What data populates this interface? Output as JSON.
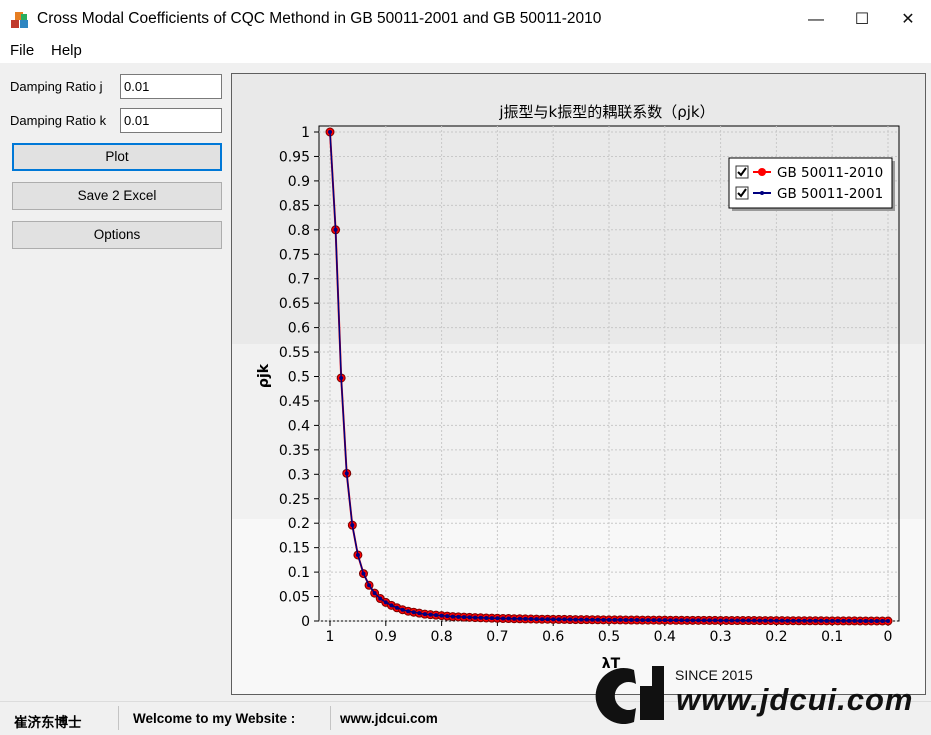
{
  "window": {
    "title": "Cross Modal Coefficients of CQC Methond in GB 50011-2001 and GB 50011-2010",
    "minimize_glyph": "—",
    "maximize_glyph": "☐",
    "close_glyph": "✕"
  },
  "menu": {
    "file": "File",
    "help": "Help"
  },
  "controls": {
    "damping_j_label": "Damping Ratio j",
    "damping_j_value": "0.01",
    "damping_k_label": "Damping Ratio k",
    "damping_k_value": "0.01",
    "plot_button": "Plot",
    "save_button": "Save 2 Excel",
    "options_button": "Options"
  },
  "status": {
    "author": "崔济东博士",
    "welcome": "Welcome to my Website :",
    "website": "www.jdcui.com"
  },
  "watermark": {
    "since": "SINCE 2015",
    "url": "www.jdcui.com"
  },
  "chart_data": {
    "type": "line",
    "title": "j振型与k振型的耦联系数（ρjk）",
    "xlabel": "λT",
    "ylabel": "ρjk",
    "x_ticks": [
      "1",
      "0.9",
      "0.8",
      "0.7",
      "0.6",
      "0.5",
      "0.4",
      "0.3",
      "0.2",
      "0.1",
      "0"
    ],
    "y_ticks": [
      "0",
      "0.05",
      "0.1",
      "0.15",
      "0.2",
      "0.25",
      "0.3",
      "0.35",
      "0.4",
      "0.45",
      "0.5",
      "0.55",
      "0.6",
      "0.65",
      "0.7",
      "0.75",
      "0.8",
      "0.85",
      "0.9",
      "0.95",
      "1"
    ],
    "xlim": [
      1,
      0
    ],
    "ylim": [
      0,
      1
    ],
    "x_reversed": true,
    "grid": true,
    "legend_position": "top-right",
    "series": [
      {
        "name": "GB 50011-2010",
        "checked": true,
        "color": "#ff0000",
        "marker": "circle-large"
      },
      {
        "name": "GB 50011-2001",
        "checked": true,
        "color": "#000080",
        "marker": "circle-small"
      }
    ],
    "x": [
      1.0,
      0.99,
      0.98,
      0.97,
      0.96,
      0.95,
      0.94,
      0.93,
      0.92,
      0.91,
      0.9,
      0.89,
      0.88,
      0.87,
      0.86,
      0.85,
      0.84,
      0.83,
      0.82,
      0.81,
      0.8,
      0.79,
      0.78,
      0.77,
      0.76,
      0.75,
      0.74,
      0.73,
      0.72,
      0.71,
      0.7,
      0.69,
      0.68,
      0.67,
      0.66,
      0.65,
      0.64,
      0.63,
      0.62,
      0.61,
      0.6,
      0.59,
      0.58,
      0.57,
      0.56,
      0.55,
      0.54,
      0.53,
      0.52,
      0.51,
      0.5,
      0.49,
      0.48,
      0.47,
      0.46,
      0.45,
      0.44,
      0.43,
      0.42,
      0.41,
      0.4,
      0.39,
      0.38,
      0.37,
      0.36,
      0.35,
      0.34,
      0.33,
      0.32,
      0.31,
      0.3,
      0.29,
      0.28,
      0.27,
      0.26,
      0.25,
      0.24,
      0.23,
      0.22,
      0.21,
      0.2,
      0.19,
      0.18,
      0.17,
      0.16,
      0.15,
      0.14,
      0.13,
      0.12,
      0.11,
      0.1,
      0.09,
      0.08,
      0.07,
      0.06,
      0.05,
      0.04,
      0.03,
      0.02,
      0.01,
      0.0
    ],
    "values": [
      1.0,
      0.8,
      0.497,
      0.302,
      0.196,
      0.135,
      0.097,
      0.073,
      0.057,
      0.046,
      0.038,
      0.032,
      0.027,
      0.023,
      0.02,
      0.018,
      0.016,
      0.014,
      0.013,
      0.012,
      0.011,
      0.01,
      0.009,
      0.0085,
      0.008,
      0.0075,
      0.007,
      0.0066,
      0.0062,
      0.0058,
      0.0055,
      0.0052,
      0.005,
      0.0047,
      0.0045,
      0.0043,
      0.0041,
      0.0039,
      0.0037,
      0.0036,
      0.0034,
      0.0033,
      0.0032,
      0.003,
      0.0029,
      0.0028,
      0.0027,
      0.0026,
      0.0025,
      0.0024,
      0.0023,
      0.0023,
      0.0022,
      0.0021,
      0.002,
      0.002,
      0.0019,
      0.0018,
      0.0018,
      0.0017,
      0.0017,
      0.0016,
      0.0015,
      0.0015,
      0.0014,
      0.0014,
      0.0013,
      0.0013,
      0.0012,
      0.0012,
      0.0011,
      0.0011,
      0.001,
      0.001,
      0.001,
      0.0009,
      0.0009,
      0.0008,
      0.0008,
      0.0008,
      0.0007,
      0.0007,
      0.0006,
      0.0006,
      0.0005,
      0.0005,
      0.0005,
      0.0004,
      0.0004,
      0.0003,
      0.0003,
      0.0003,
      0.0002,
      0.0002,
      0.0002,
      0.0001,
      0.0001,
      0.0001,
      0.0001,
      0.0,
      0.0
    ]
  }
}
